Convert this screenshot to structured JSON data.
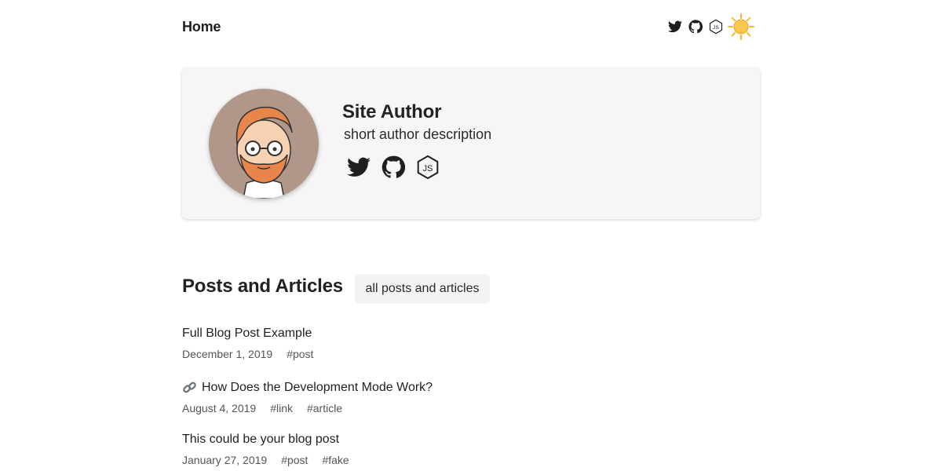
{
  "header": {
    "home_label": "Home",
    "icons": [
      "twitter-icon",
      "github-icon",
      "nodejs-icon"
    ],
    "theme_icon": "sun-icon"
  },
  "author": {
    "name": "Site Author",
    "description": "short author description",
    "icons": [
      "twitter-icon",
      "github-icon",
      "nodejs-icon"
    ]
  },
  "posts_section": {
    "title": "Posts and Articles",
    "all_button_label": "all posts and articles",
    "items": [
      {
        "title": "Full Blog Post Example",
        "date": "December 1, 2019",
        "tags": [
          "#post"
        ]
      },
      {
        "icon": "link-icon",
        "title": "How Does the Development Mode Work?",
        "date": "August 4, 2019",
        "tags": [
          "#link",
          "#article"
        ]
      },
      {
        "title": "This could be your blog post",
        "date": "January 27, 2019",
        "tags": [
          "#post",
          "#fake"
        ]
      }
    ]
  },
  "colors": {
    "card_background": "#f6f6f6",
    "avatar_background": "#b0978a",
    "text": "#1f1f1f",
    "meta_text": "#555555",
    "sun": "#f7b731"
  }
}
